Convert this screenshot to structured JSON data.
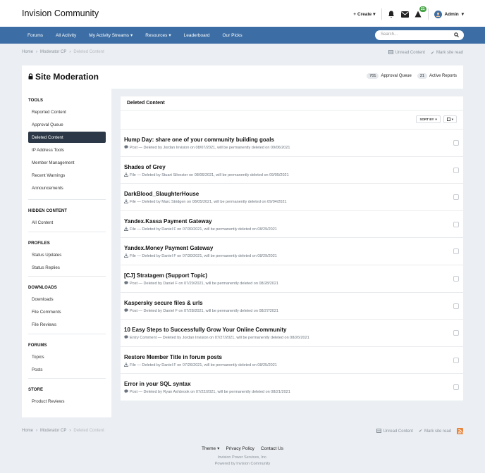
{
  "header": {
    "site_title": "Invision Community",
    "create_label": "Create",
    "notification_count": "21",
    "user_name": "Admin"
  },
  "nav": {
    "items": [
      {
        "label": "Forums",
        "dropdown": false
      },
      {
        "label": "All Activity",
        "dropdown": false
      },
      {
        "label": "My Activity Streams",
        "dropdown": true
      },
      {
        "label": "Resources",
        "dropdown": true
      },
      {
        "label": "Leaderboard",
        "dropdown": false
      },
      {
        "label": "Our Picks",
        "dropdown": false
      }
    ],
    "search_placeholder": "Search..."
  },
  "breadcrumb": {
    "items": [
      "Home",
      "Moderator CP",
      "Deleted Content"
    ],
    "unread_label": "Unread Content",
    "mark_read_label": "Mark site read"
  },
  "page": {
    "title": "Site Moderation",
    "approval_count": "701",
    "approval_label": "Approval Queue",
    "reports_count": "21",
    "reports_label": "Active Reports"
  },
  "sidebar": {
    "sections": [
      {
        "title": "TOOLS",
        "items": [
          "Reported Content",
          "Approval Queue",
          "Deleted Content",
          "IP Address Tools",
          "Member Management",
          "Recent Warnings",
          "Announcements"
        ]
      },
      {
        "title": "HIDDEN CONTENT",
        "items": [
          "All Content"
        ]
      },
      {
        "title": "PROFILES",
        "items": [
          "Status Updates",
          "Status Replies"
        ]
      },
      {
        "title": "DOWNLOADS",
        "items": [
          "Downloads",
          "File Comments",
          "File Reviews"
        ]
      },
      {
        "title": "FORUMS",
        "items": [
          "Topics",
          "Posts"
        ]
      },
      {
        "title": "STORE",
        "items": [
          "Product Reviews"
        ]
      }
    ],
    "active_item": "Deleted Content"
  },
  "main": {
    "title": "Deleted Content",
    "sort_label": "SORT BY",
    "rows": [
      {
        "title": "Hump Day: share one of your community building goals",
        "icon": "comment-icon",
        "meta": "Post — Deleted by Jordan Invision on 08/07/2021, will be permanently deleted on 09/06/2021"
      },
      {
        "title": "Shades of Grey",
        "icon": "download-icon",
        "meta": "File — Deleted by Stuart Silvester on 08/06/2021, will be permanently deleted on 09/05/2021"
      },
      {
        "title": "DarkBlood_SlaughterHouse",
        "icon": "download-icon",
        "meta": "File — Deleted by Marc Stridgen on 08/05/2021, will be permanently deleted on 09/04/2021"
      },
      {
        "title": "Yandex.Kassa Payment Gateway",
        "icon": "download-icon",
        "meta": "File — Deleted by Daniel F on 07/30/2021, will be permanently deleted on 08/29/2021"
      },
      {
        "title": "Yandex.Money Payment Gateway",
        "icon": "download-icon",
        "meta": "File — Deleted by Daniel F on 07/30/2021, will be permanently deleted on 08/29/2021"
      },
      {
        "title": "[CJ] Stratagem (Support Topic)",
        "icon": "comment-icon",
        "meta": "Post — Deleted by Daniel F on 07/29/2021, will be permanently deleted on 08/28/2021"
      },
      {
        "title": "Kaspersky secure files & urls",
        "icon": "comment-icon",
        "meta": "Post — Deleted by Daniel F on 07/28/2021, will be permanently deleted on 08/27/2021"
      },
      {
        "title": "10 Easy Steps to Successfully Grow Your Online Community",
        "icon": "comment-icon",
        "meta": "Entry Comment — Deleted by Jordan Invision on 07/27/2021, will be permanently deleted on 08/26/2021"
      },
      {
        "title": "Restore Member Title in forum posts",
        "icon": "download-icon",
        "meta": "File — Deleted by Daniel F on 07/26/2021, will be permanently deleted on 08/25/2021"
      },
      {
        "title": "Error in your SQL syntax",
        "icon": "comment-icon",
        "meta": "Post — Deleted by Ryan Ashbrook on 07/22/2021, will be permanently deleted on 08/21/2021"
      }
    ]
  },
  "footer": {
    "links": [
      "Theme",
      "Privacy Policy",
      "Contact Us"
    ],
    "company": "Invision Power Services, Inc.",
    "powered": "Powered by Invision Community"
  },
  "colors": {
    "nav_bg": "#3c6ea5",
    "active_item_bg": "#2c3847",
    "page_bg": "#ebeef2",
    "badge_green": "#47a447",
    "rss_orange": "#e8853d"
  }
}
